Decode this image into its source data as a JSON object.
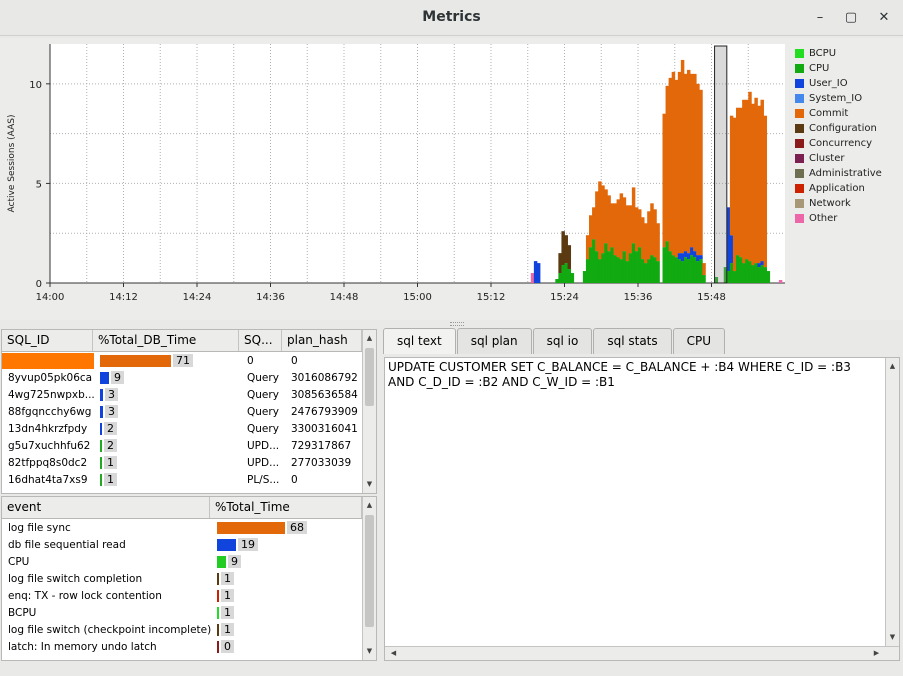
{
  "window": {
    "title": "Metrics",
    "minimize_glyph": "–",
    "maximize_glyph": "▢",
    "close_glyph": "✕"
  },
  "chart_data": {
    "type": "area",
    "ylabel": "Active Sessions (AAS)",
    "xlabel": "",
    "ylim": [
      0,
      12
    ],
    "yticks": [
      0,
      5,
      10
    ],
    "xticks": [
      "14:00",
      "14:12",
      "14:24",
      "14:36",
      "14:48",
      "15:00",
      "15:12",
      "15:24",
      "15:36",
      "15:48"
    ],
    "xrange_minutes": [
      0,
      120
    ],
    "grid": true,
    "legend_position": "right",
    "series": [
      {
        "name": "BCPU",
        "color": "#22dd22"
      },
      {
        "name": "CPU",
        "color": "#11aa11"
      },
      {
        "name": "User_IO",
        "color": "#1144dd"
      },
      {
        "name": "System_IO",
        "color": "#4488ee"
      },
      {
        "name": "Commit",
        "color": "#e2680a"
      },
      {
        "name": "Configuration",
        "color": "#5b3a12"
      },
      {
        "name": "Concurrency",
        "color": "#8b1a1a"
      },
      {
        "name": "Cluster",
        "color": "#7b2050"
      },
      {
        "name": "Administrative",
        "color": "#6e6e50"
      },
      {
        "name": "Application",
        "color": "#cc2200"
      },
      {
        "name": "Network",
        "color": "#a89878"
      },
      {
        "name": "Other",
        "color": "#ee66aa"
      }
    ],
    "samples": [
      {
        "t": 78.5,
        "Other": 0.5
      },
      {
        "t": 79.0,
        "User_IO": 1.1
      },
      {
        "t": 79.5,
        "User_IO": 1.0
      },
      {
        "t": 82.5,
        "CPU": 0.2
      },
      {
        "t": 83.0,
        "CPU": 0.5,
        "Configuration": 1.0
      },
      {
        "t": 83.5,
        "CPU": 0.9,
        "Configuration": 1.7
      },
      {
        "t": 84.0,
        "CPU": 1.0,
        "Configuration": 1.4
      },
      {
        "t": 84.5,
        "CPU": 0.7,
        "Configuration": 1.2
      },
      {
        "t": 85.0,
        "CPU": 0.5
      },
      {
        "t": 87.0,
        "CPU": 0.6
      },
      {
        "t": 87.5,
        "CPU": 1.2,
        "Commit": 1.2
      },
      {
        "t": 88.0,
        "CPU": 1.8,
        "Commit": 1.6
      },
      {
        "t": 88.5,
        "CPU": 2.2,
        "Commit": 1.6
      },
      {
        "t": 89.0,
        "CPU": 1.6,
        "Commit": 3.0
      },
      {
        "t": 89.5,
        "CPU": 1.2,
        "Commit": 3.9
      },
      {
        "t": 90.0,
        "CPU": 1.5,
        "Commit": 3.4
      },
      {
        "t": 90.5,
        "CPU": 2.0,
        "Commit": 2.7
      },
      {
        "t": 91.0,
        "CPU": 1.6,
        "Commit": 2.8
      },
      {
        "t": 91.5,
        "CPU": 1.8,
        "Commit": 2.2
      },
      {
        "t": 92.0,
        "CPU": 1.4,
        "Commit": 2.6
      },
      {
        "t": 92.5,
        "CPU": 1.3,
        "Commit": 2.9
      },
      {
        "t": 93.0,
        "CPU": 1.2,
        "Commit": 3.3
      },
      {
        "t": 93.5,
        "CPU": 1.6,
        "Commit": 2.7
      },
      {
        "t": 94.0,
        "CPU": 1.1,
        "Commit": 2.8
      },
      {
        "t": 94.5,
        "CPU": 1.5,
        "Commit": 2.4
      },
      {
        "t": 95.0,
        "CPU": 2.0,
        "Commit": 2.8
      },
      {
        "t": 95.5,
        "CPU": 1.6,
        "Commit": 2.2
      },
      {
        "t": 96.0,
        "CPU": 1.8,
        "Commit": 1.9
      },
      {
        "t": 96.5,
        "CPU": 1.2,
        "Commit": 2.1
      },
      {
        "t": 97.0,
        "CPU": 1.0,
        "Commit": 2.0
      },
      {
        "t": 97.5,
        "CPU": 1.2,
        "Commit": 2.4
      },
      {
        "t": 98.0,
        "CPU": 1.4,
        "Commit": 2.6
      },
      {
        "t": 98.5,
        "CPU": 1.3,
        "Commit": 2.4
      },
      {
        "t": 99.0,
        "CPU": 1.1,
        "Commit": 1.9
      },
      {
        "t": 100.0,
        "CPU": 1.8,
        "Commit": 6.7
      },
      {
        "t": 100.5,
        "CPU": 2.1,
        "Commit": 7.8
      },
      {
        "t": 101.0,
        "CPU": 1.6,
        "Commit": 8.7
      },
      {
        "t": 101.5,
        "CPU": 1.4,
        "Commit": 9.2
      },
      {
        "t": 102.0,
        "CPU": 1.3,
        "Commit": 8.9
      },
      {
        "t": 102.5,
        "CPU": 1.2,
        "User_IO": 0.3,
        "Commit": 9.1
      },
      {
        "t": 103.0,
        "CPU": 1.1,
        "User_IO": 0.4,
        "Commit": 9.7
      },
      {
        "t": 103.5,
        "CPU": 1.3,
        "User_IO": 0.3,
        "Commit": 8.9
      },
      {
        "t": 104.0,
        "CPU": 1.2,
        "User_IO": 0.3,
        "Commit": 9.2
      },
      {
        "t": 104.5,
        "CPU": 1.4,
        "User_IO": 0.4,
        "Commit": 8.7
      },
      {
        "t": 105.0,
        "CPU": 1.3,
        "User_IO": 0.3,
        "Commit": 8.9
      },
      {
        "t": 105.5,
        "CPU": 1.1,
        "User_IO": 0.3,
        "Commit": 8.6
      },
      {
        "t": 106.0,
        "CPU": 1.2,
        "User_IO": 0.2,
        "Commit": 8.3
      },
      {
        "t": 106.5,
        "CPU": 0.4,
        "Commit": 0.6
      },
      {
        "t": 108.5,
        "CPU": 0.3
      },
      {
        "t": 110.0,
        "CPU": 0.8
      },
      {
        "t": 110.5,
        "CPU": 0.6,
        "User_IO": 3.2
      },
      {
        "t": 111.0,
        "CPU": 1.0,
        "User_IO": 1.4,
        "Commit": 6.0
      },
      {
        "t": 111.5,
        "CPU": 0.6,
        "Commit": 7.7
      },
      {
        "t": 112.0,
        "CPU": 1.4,
        "Commit": 7.4
      },
      {
        "t": 112.5,
        "CPU": 1.3,
        "Commit": 7.5
      },
      {
        "t": 113.0,
        "CPU": 1.0,
        "Commit": 8.2
      },
      {
        "t": 113.5,
        "CPU": 1.2,
        "Commit": 8.0
      },
      {
        "t": 114.0,
        "CPU": 1.1,
        "Commit": 8.5
      },
      {
        "t": 114.5,
        "CPU": 0.9,
        "Commit": 8.1
      },
      {
        "t": 115.0,
        "CPU": 1.0,
        "Commit": 8.3
      },
      {
        "t": 115.5,
        "CPU": 0.8,
        "User_IO": 0.2,
        "Commit": 7.9
      },
      {
        "t": 116.0,
        "CPU": 0.9,
        "User_IO": 0.2,
        "Commit": 8.1
      },
      {
        "t": 116.5,
        "CPU": 0.8,
        "Commit": 7.6
      },
      {
        "t": 117.0,
        "CPU": 0.6
      },
      {
        "t": 119.0,
        "Other": 0.15
      }
    ],
    "selection_window": [
      108.5,
      110.5
    ]
  },
  "sql_table": {
    "columns": [
      "SQL_ID",
      "%Total_DB_Time",
      "SQ...",
      "plan_hash"
    ],
    "rows": [
      {
        "sql_id": "",
        "pct": 71,
        "pct_label": "71",
        "sq": "0",
        "plan_hash": "0",
        "color": "#e2680a",
        "sql_color": "#ff7700"
      },
      {
        "sql_id": "8yvup05pk06ca",
        "pct": 9,
        "pct_label": "9",
        "sq": "Query",
        "plan_hash": "3016086792",
        "color": "#1144dd"
      },
      {
        "sql_id": "4wg725nwpxb...",
        "pct": 3,
        "pct_label": "3",
        "sq": "Query",
        "plan_hash": "3085636584",
        "color": "#1144dd"
      },
      {
        "sql_id": "88fgqncchy6wg",
        "pct": 3,
        "pct_label": "3",
        "sq": "Query",
        "plan_hash": "2476793909",
        "color": "#1144dd"
      },
      {
        "sql_id": "13dn4hkrzfpdy",
        "pct": 2,
        "pct_label": "2",
        "sq": "Query",
        "plan_hash": "3300316041",
        "color": "#1144dd"
      },
      {
        "sql_id": "g5u7xuchhfu62",
        "pct": 2,
        "pct_label": "2",
        "sq": "UPD...",
        "plan_hash": "729317867",
        "color": "#22aa22"
      },
      {
        "sql_id": "82tfppq8s0dc2",
        "pct": 1,
        "pct_label": "1",
        "sq": "UPD...",
        "plan_hash": "277033039",
        "color": "#22aa22"
      },
      {
        "sql_id": "16dhat4ta7xs9",
        "pct": 1,
        "pct_label": "1",
        "sq": "PL/S...",
        "plan_hash": "0",
        "color": "#22aa22"
      }
    ]
  },
  "event_table": {
    "columns": [
      "event",
      "%Total_Time"
    ],
    "rows": [
      {
        "event": "log file sync",
        "pct": 68,
        "pct_label": "68",
        "color": "#e2680a"
      },
      {
        "event": "db file sequential read",
        "pct": 19,
        "pct_label": "19",
        "color": "#1144dd"
      },
      {
        "event": "CPU",
        "pct": 9,
        "pct_label": "9",
        "color": "#22cc22"
      },
      {
        "event": "log file switch completion",
        "pct": 1,
        "pct_label": "1",
        "color": "#5b3a12"
      },
      {
        "event": "enq: TX - row lock contention",
        "pct": 1,
        "pct_label": "1",
        "color": "#cc2200"
      },
      {
        "event": "BCPU",
        "pct": 1,
        "pct_label": "1",
        "color": "#22dd22"
      },
      {
        "event": "log file switch (checkpoint incomplete)",
        "pct": 1,
        "pct_label": "1",
        "color": "#5b3a12"
      },
      {
        "event": "latch: In memory undo latch",
        "pct": 0,
        "pct_label": "0",
        "color": "#8b1a1a"
      }
    ]
  },
  "tabs": [
    "sql text",
    "sql plan",
    "sql io",
    "sql stats",
    "CPU"
  ],
  "active_tab": 0,
  "sql_text": "UPDATE CUSTOMER SET C_BALANCE = C_BALANCE + :B4 WHERE C_ID = :B3 AND C_D_ID = :B2 AND C_W_ID = :B1",
  "icons": {
    "scroll_up": "▲",
    "scroll_down": "▼",
    "scroll_left": "◀",
    "scroll_right": "▶",
    "splitter": "⋮"
  }
}
